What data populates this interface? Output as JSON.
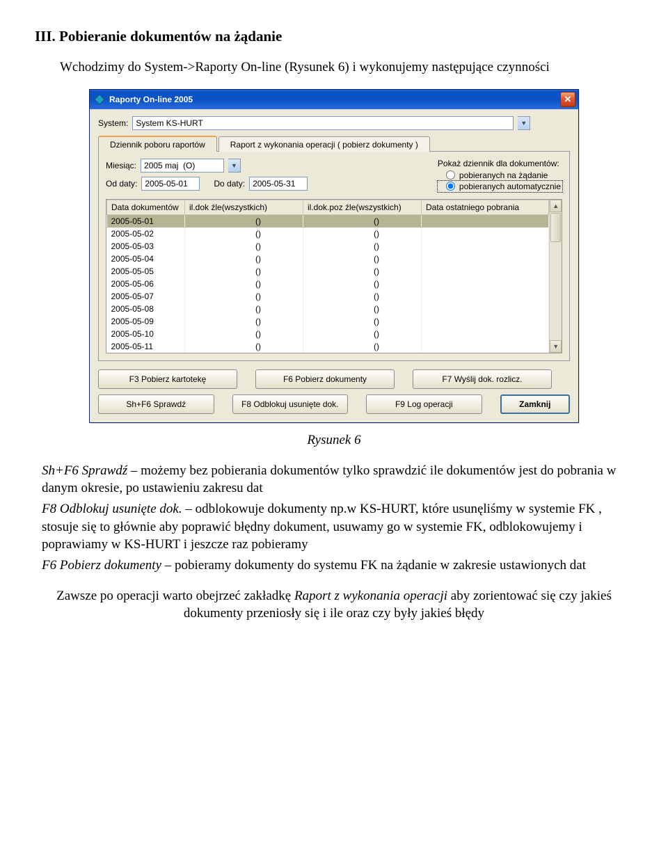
{
  "doc": {
    "heading": "III. Pobieranie dokumentów na żądanie",
    "intro": "Wchodzimy do System->Raporty On-line (Rysunek 6) i wykonujemy następujące czynności",
    "caption": "Rysunek 6",
    "list": {
      "e1_i": "Sh+F6 Sprawdź",
      "e1_r": " – możemy bez pobierania dokumentów tylko sprawdzić ile dokumentów jest do pobrania w danym okresie, po ustawieniu zakresu dat",
      "e2_i": "F8 Odblokuj usunięte dok.",
      "e2_r": " – odblokowuje dokumenty np.w KS-HURT, które usunęliśmy w systemie FK , stosuje się to głównie aby poprawić błędny dokument, usuwamy go w systemie FK, odblokowujemy i poprawiamy w KS-HURT i jeszcze raz pobieramy",
      "e3_i": "F6 Pobierz dokumenty",
      "e3_r": " – pobieramy dokumenty do systemu FK na żądanie w zakresie ustawionych dat"
    },
    "final1": "Zawsze po operacji warto obejrzeć zakładkę ",
    "final_i": "Raport z wykonania operacji",
    "final2": " aby zorientować się czy jakieś dokumenty przeniosły się i ile oraz czy były jakieś błędy"
  },
  "win": {
    "title": "Raporty On-line 2005",
    "system_lbl": "System:",
    "system_val": "System KS-HURT",
    "tab1": "Dziennik poboru raportów",
    "tab2": "Raport z wykonania operacji ( pobierz dokumenty )",
    "month_lbl": "Miesiąc:",
    "month_val": "2005 maj  (O)",
    "from_lbl": "Od daty:",
    "from_val": "2005-05-01",
    "to_lbl": "Do daty:",
    "to_val": "2005-05-31",
    "radio_title": "Pokaż dziennik dla dokumentów:",
    "radio1": "pobieranych na żądanie",
    "radio2": "pobieranych automatycznie",
    "cols": {
      "c1": "Data dokumentów",
      "c2": "il.dok  źle(wszystkich)",
      "c3": "il.dok.poz  źle(wszystkich)",
      "c4": "Data ostatniego pobrania"
    },
    "rows": [
      {
        "d": "2005-05-01",
        "a": "()",
        "b": "()",
        "c": "",
        "sel": true
      },
      {
        "d": "2005-05-02",
        "a": "()",
        "b": "()",
        "c": ""
      },
      {
        "d": "2005-05-03",
        "a": "()",
        "b": "()",
        "c": ""
      },
      {
        "d": "2005-05-04",
        "a": "()",
        "b": "()",
        "c": ""
      },
      {
        "d": "2005-05-05",
        "a": "()",
        "b": "()",
        "c": ""
      },
      {
        "d": "2005-05-06",
        "a": "()",
        "b": "()",
        "c": ""
      },
      {
        "d": "2005-05-07",
        "a": "()",
        "b": "()",
        "c": ""
      },
      {
        "d": "2005-05-08",
        "a": "()",
        "b": "()",
        "c": ""
      },
      {
        "d": "2005-05-09",
        "a": "()",
        "b": "()",
        "c": ""
      },
      {
        "d": "2005-05-10",
        "a": "()",
        "b": "()",
        "c": ""
      },
      {
        "d": "2005-05-11",
        "a": "()",
        "b": "()",
        "c": ""
      }
    ],
    "btns": {
      "b1": "F3 Pobierz kartotekę",
      "b2": "F6 Pobierz dokumenty",
      "b3": "F7 Wyślij dok. rozlicz.",
      "b4": "Sh+F6 Sprawdź",
      "b5": "F8 Odblokuj usunięte dok.",
      "b6": "F9 Log operacji",
      "b7": "Zamknij"
    }
  }
}
